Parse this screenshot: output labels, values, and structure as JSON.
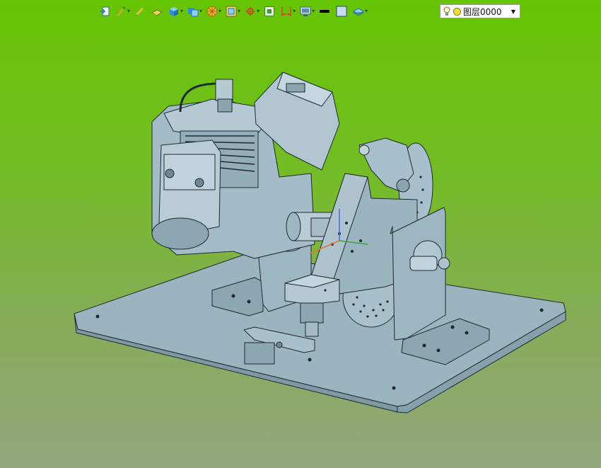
{
  "toolbar": {
    "buttons": [
      {
        "name": "exit-sketch-icon",
        "has_dropdown": false
      },
      {
        "name": "pen-tool-icon",
        "has_dropdown": true
      },
      {
        "name": "pencil-icon",
        "has_dropdown": false
      },
      {
        "name": "sketch-plane-icon",
        "has_dropdown": false
      },
      {
        "name": "shaded-cube-icon",
        "has_dropdown": true
      },
      {
        "name": "view-cube-icon",
        "has_dropdown": true
      },
      {
        "name": "section-wheel-icon",
        "has_dropdown": true
      },
      {
        "name": "wireframe-box-icon",
        "has_dropdown": true
      },
      {
        "name": "snap-target-icon",
        "has_dropdown": true
      },
      {
        "name": "fit-view-icon",
        "has_dropdown": false
      },
      {
        "name": "dimension-icon",
        "has_dropdown": true
      },
      {
        "name": "display-monitor-icon",
        "has_dropdown": true
      },
      {
        "name": "line-color-icon",
        "has_dropdown": false
      },
      {
        "name": "fill-color-icon",
        "has_dropdown": false
      },
      {
        "name": "layer-stack-icon",
        "has_dropdown": true
      }
    ],
    "dropdown_glyph": "▾"
  },
  "layer_selector": {
    "bulb_icon": "lightbulb-icon",
    "value": "图层0000",
    "arrow": "▼"
  },
  "colors": {
    "viewport_top": "#66c503",
    "viewport_bottom": "#93a67c",
    "model_fill": "#9cb6c2",
    "model_edge": "#1f2a30"
  }
}
